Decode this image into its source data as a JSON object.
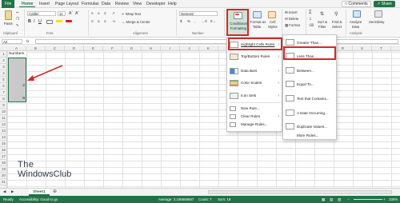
{
  "menu_tabs": [
    "File",
    "Home",
    "Insert",
    "Page Layout",
    "Formulas",
    "Data",
    "Review",
    "View",
    "Developer",
    "Help"
  ],
  "top_buttons": {
    "comments": "Comments",
    "share": "Share"
  },
  "ribbon": {
    "paste_label": "Paste",
    "font_name": "Calibri",
    "font_size": "11",
    "wrap_text": "Wrap Text",
    "merge_center": "Merge & Center",
    "number_format": "General",
    "conditional_formatting_l1": "Conditional",
    "conditional_formatting_l2": "Formatting",
    "format_as_table_l1": "Format as",
    "format_as_table_l2": "Table",
    "cell_styles_l1": "Cell",
    "cell_styles_l2": "Styles",
    "insert": "Insert",
    "delete": "Delete",
    "format": "Format",
    "sort_filter_l1": "Sort &",
    "sort_filter_l2": "Filter",
    "find_select_l1": "Find &",
    "find_select_l2": "Select",
    "analyze_data_l1": "Analyze",
    "analyze_data_l2": "Data",
    "sensitivity": "Sensitivity",
    "groups": [
      "Clipboard",
      "Font",
      "Alignment",
      "Number"
    ],
    "ideas_group": "Analysis"
  },
  "formula_bar": {
    "name_box": "A2",
    "fx": "fx"
  },
  "columns": [
    "A",
    "B",
    "C",
    "D",
    "E",
    "F",
    "G",
    "H",
    "I",
    "J",
    "K",
    "L",
    "M",
    "N",
    "O",
    "P",
    "Q",
    "R",
    "S",
    "T"
  ],
  "rows": [
    "1",
    "2",
    "3",
    "4",
    "5",
    "6",
    "7",
    "8",
    "9",
    "10",
    "11",
    "12",
    "13",
    "14",
    "15",
    "16",
    "17",
    "18",
    "19",
    "20",
    "21"
  ],
  "sheet": {
    "header": "Numbers",
    "values": [
      "",
      "",
      "",
      "",
      "2",
      "",
      "8"
    ]
  },
  "cf_menu": {
    "items": [
      "Highlight Cells Rules",
      "Top/Bottom Rules",
      "Data Bars",
      "Color Scales",
      "Icon Sets",
      "New Rule...",
      "Clear Rules",
      "Manage Rules..."
    ]
  },
  "submenu": {
    "items": [
      "Greater Than...",
      "Less Than...",
      "Between...",
      "Equal To...",
      "Text that Contains...",
      "A Date Occurring...",
      "Duplicate Values..."
    ],
    "more": "More Rules..."
  },
  "sheet_tab": "Sheet1",
  "status": {
    "ready": "Ready",
    "accessibility": "Accessibility: Good to go",
    "average": "Average: 3.166666667",
    "count": "Count: 7",
    "sum": "Sum: 19",
    "zoom": "100%"
  },
  "watermark": {
    "line1": "The",
    "line2": "WindowsClub"
  },
  "colors": {
    "excel_green": "#217346",
    "highlight_red": "#d02a2a",
    "selection_gray": "#c9c9c9"
  }
}
